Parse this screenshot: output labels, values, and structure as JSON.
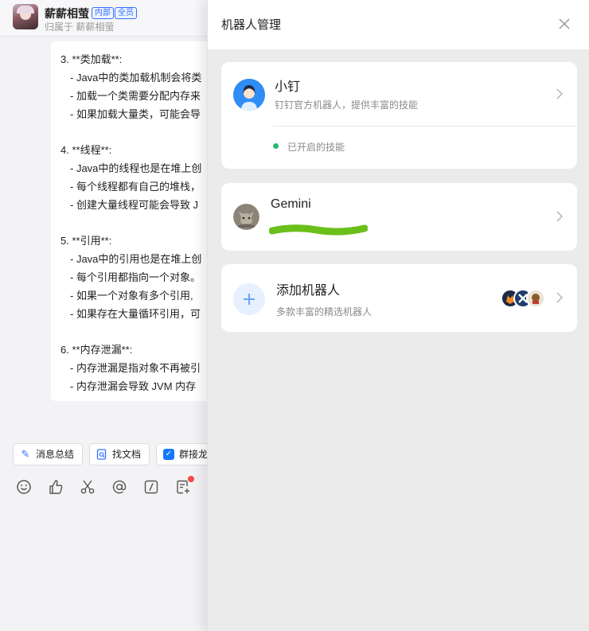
{
  "chat": {
    "group_name": "薪薪相萤",
    "tag_internal": "内部",
    "tag_all": "全员",
    "belongs_to": "归属于 薪薪相萤",
    "message_lines": [
      "3. **类加载**:",
      "- Java中的类加载机制会将类",
      "- 加载一个类需要分配内存来",
      "- 如果加载大量类，可能会导",
      "4. **线程**:",
      "- Java中的线程也是在堆上创",
      "- 每个线程都有自己的堆栈，",
      "- 创建大量线程可能会导致 J",
      "5. **引用**:",
      "- Java中的引用也是在堆上创",
      "- 每个引用都指向一个对象。",
      "- 如果一个对象有多个引用,",
      "- 如果存在大量循环引用，可",
      "6. **内存泄漏**:",
      "- 内存泄漏是指对象不再被引",
      "- 内存泄漏会导致 JVM 内存"
    ],
    "quick_actions": [
      {
        "label": "消息总结",
        "icon": "sparkle-icon"
      },
      {
        "label": "找文档",
        "icon": "doc-search-icon"
      },
      {
        "label": "群接龙",
        "icon": "app-icon"
      }
    ],
    "toolbar_icons": [
      "emoji-icon",
      "thumbs-up-icon",
      "scissors-icon",
      "at-icon",
      "slash-command-icon",
      "note-add-icon"
    ]
  },
  "panel": {
    "title": "机器人管理",
    "bots": [
      {
        "name": "小钉",
        "desc": "钉钉官方机器人，提供丰富的技能",
        "status": "已开启的技能"
      },
      {
        "name": "Gemini",
        "desc": ""
      }
    ],
    "add_bot": {
      "name": "添加机器人",
      "desc": "多款丰富的精选机器人"
    }
  },
  "colors": {
    "accent": "#3370ff",
    "status_green": "#2bb673",
    "scribble": "#6bbf1a",
    "badge_red": "#f54a45"
  }
}
